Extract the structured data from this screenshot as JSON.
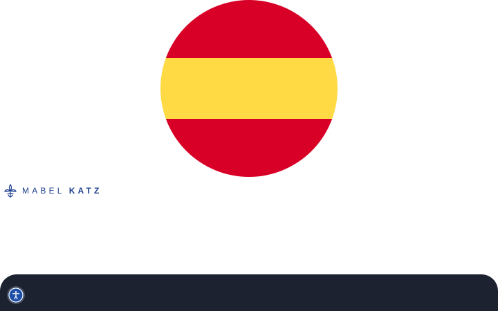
{
  "page": {
    "background_color": "#ffffff"
  },
  "language_flag": {
    "icon": "spain-flag-icon",
    "colors": {
      "red": "#d80027",
      "yellow": "#ffda44"
    }
  },
  "logo": {
    "icon": "fleur-de-lis-icon",
    "first_name": "MABEL",
    "last_name": "KATZ",
    "color": "#1e3f8f"
  },
  "bottom_bar": {
    "color": "#1c2230"
  },
  "accessibility_button": {
    "icon": "accessibility-person-icon",
    "color": "#1e4fa8"
  }
}
